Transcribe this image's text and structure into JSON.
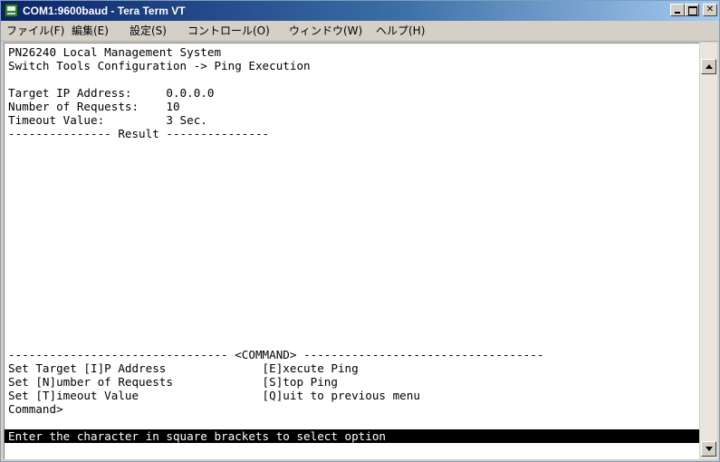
{
  "window": {
    "title": "COM1:9600baud - Tera Term VT"
  },
  "menu": {
    "items": [
      "ファイル(F)",
      "編集(E)",
      "設定(S)",
      "コントロール(O)",
      "ウィンドウ(W)",
      "ヘルプ(H)"
    ]
  },
  "terminal": {
    "lines": [
      "PN26240 Local Management System",
      "Switch Tools Configuration -> Ping Execution",
      "",
      "Target IP Address:     0.0.0.0",
      "Number of Requests:    10",
      "Timeout Value:         3 Sec.",
      "--------------- Result ---------------"
    ],
    "command_header": "-------------------------------- <COMMAND> -----------------------------------",
    "command_lines": [
      "Set Target [I]P Address              [E]xecute Ping",
      "Set [N]umber of Requests             [S]top Ping",
      "Set [T]imeout Value                  [Q]uit to previous menu",
      "Command>"
    ],
    "status": "Enter the character in square brackets to select option"
  },
  "colors": {
    "title_bar": "#0a246a",
    "terminal_bg": "#ffffff",
    "terminal_fg": "#000000",
    "status_bg": "#000000",
    "status_fg": "#ffffff"
  },
  "icons": {
    "app": "teraterm-app-icon",
    "minimize": "minimize-icon",
    "maximize": "maximize-icon",
    "close": "close-icon",
    "scroll_up": "scroll-up-arrow-icon",
    "scroll_down": "scroll-down-arrow-icon"
  }
}
